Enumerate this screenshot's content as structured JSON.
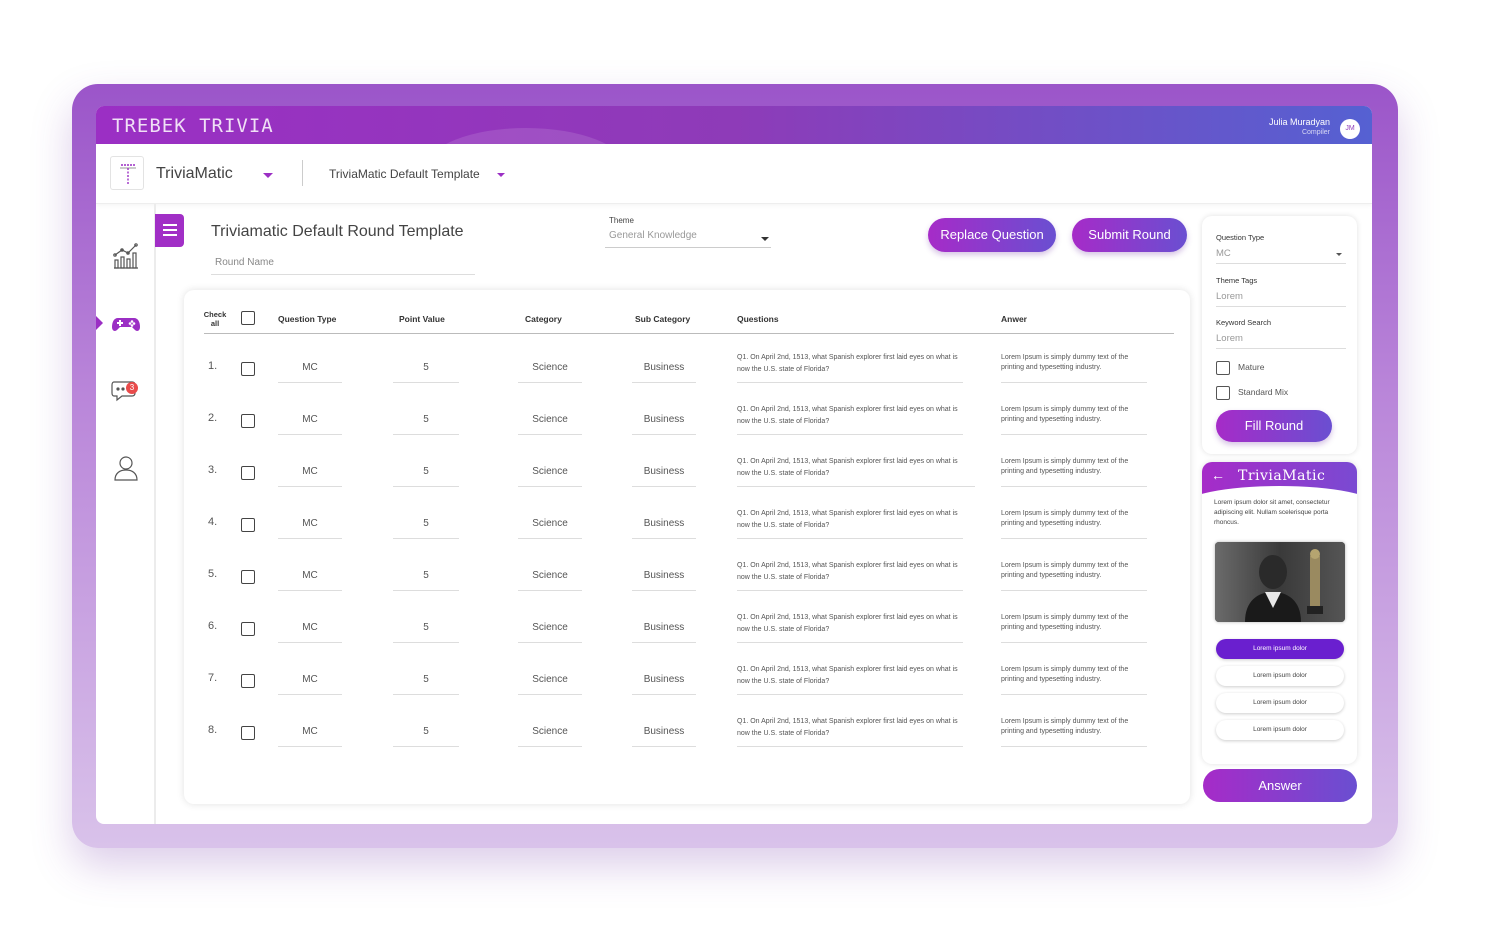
{
  "app": {
    "brand": "TREBEK TRIVIA",
    "user_name": "Julia Muradyan",
    "user_role": "Compiler",
    "user_initials": "JM"
  },
  "subheader": {
    "app_name": "TriviaMatic",
    "template_name": "TriviaMatic Default Template"
  },
  "sidebar": {
    "items": [
      {
        "icon": "chart-icon"
      },
      {
        "icon": "gamepad-icon",
        "active": true
      },
      {
        "icon": "chat-icon",
        "badge": "3"
      },
      {
        "icon": "user-icon"
      }
    ]
  },
  "round": {
    "title": "Triviamatic Default Round Template",
    "name_placeholder": "Round Name",
    "theme_label": "Theme",
    "theme_value": "General Knowledge",
    "replace_label": "Replace Question",
    "submit_label": "Submit Round"
  },
  "table": {
    "headers": {
      "check_all": "Check all",
      "question_type": "Question Type",
      "point_value": "Point Value",
      "category": "Category",
      "sub_category": "Sub Category",
      "questions": "Questions",
      "answer": "Anwer"
    },
    "rows": [
      {
        "num": "1.",
        "type": "MC",
        "points": "5",
        "category": "Science",
        "sub": "Business",
        "question": "Q1. On April 2nd, 1513, what Spanish explorer first laid eyes on what is now the U.S. state of Florida?",
        "answer": "Lorem Ipsum is simply dummy text of the printing and typesetting industry."
      },
      {
        "num": "2.",
        "type": "MC",
        "points": "5",
        "category": "Science",
        "sub": "Business",
        "question": "Q1. On April 2nd, 1513, what Spanish explorer first laid eyes on what is now the U.S. state of Florida?",
        "answer": "Lorem Ipsum is simply dummy text of the printing and typesetting industry."
      },
      {
        "num": "3.",
        "type": "MC",
        "points": "5",
        "category": "Science",
        "sub": "Business",
        "question": "Q1. On April 2nd, 1513, what Spanish explorer first laid eyes on what is now the U.S. state of Florida?",
        "answer": "Lorem Ipsum is simply dummy text of the printing and typesetting industry."
      },
      {
        "num": "4.",
        "type": "MC",
        "points": "5",
        "category": "Science",
        "sub": "Business",
        "question": "Q1. On April 2nd, 1513, what Spanish explorer first laid eyes on what is now the U.S. state of Florida?",
        "answer": "Lorem Ipsum is simply dummy text of the printing and typesetting industry."
      },
      {
        "num": "5.",
        "type": "MC",
        "points": "5",
        "category": "Science",
        "sub": "Business",
        "question": "Q1. On April 2nd, 1513, what Spanish explorer first laid eyes on what is now the U.S. state of Florida?",
        "answer": "Lorem Ipsum is simply dummy text of the printing and typesetting industry."
      },
      {
        "num": "6.",
        "type": "MC",
        "points": "5",
        "category": "Science",
        "sub": "Business",
        "question": "Q1. On April 2nd, 1513, what Spanish explorer first laid eyes on what is now the U.S. state of Florida?",
        "answer": "Lorem Ipsum is simply dummy text of the printing and typesetting industry."
      },
      {
        "num": "7.",
        "type": "MC",
        "points": "5",
        "category": "Science",
        "sub": "Business",
        "question": "Q1. On April 2nd, 1513, what Spanish explorer first laid eyes on what is now the U.S. state of Florida?",
        "answer": "Lorem Ipsum is simply dummy text of the printing and typesetting industry."
      },
      {
        "num": "8.",
        "type": "MC",
        "points": "5",
        "category": "Science",
        "sub": "Business",
        "question": "Q1. On April 2nd, 1513, what Spanish explorer first laid eyes on what is now the U.S. state of Florida?",
        "answer": "Lorem Ipsum is simply dummy text of the printing and typesetting industry."
      }
    ]
  },
  "filters": {
    "question_type_label": "Question Type",
    "question_type_value": "MC",
    "theme_tags_label": "Theme Tags",
    "theme_tags_value": "Lorem",
    "keyword_label": "Keyword Search",
    "keyword_value": "Lorem",
    "mature_label": "Mature",
    "standard_mix_label": "Standard Mix",
    "fill_round_label": "Fill Round"
  },
  "preview": {
    "back_glyph": "←",
    "title": "TriviaMatic",
    "description": "Lorem ipsum dolor sit amet, consectetur adipiscing elit. Nullam scelerisque porta rhoncus.",
    "options": [
      "Lorem ipsum dolor",
      "Lorem ipsum dolor",
      "Lorem ipsum dolor",
      "Lorem ipsum dolor"
    ],
    "answer_label": "Answer"
  },
  "colors": {
    "accent": "#9b2fc4",
    "accent_end": "#5561d2"
  }
}
